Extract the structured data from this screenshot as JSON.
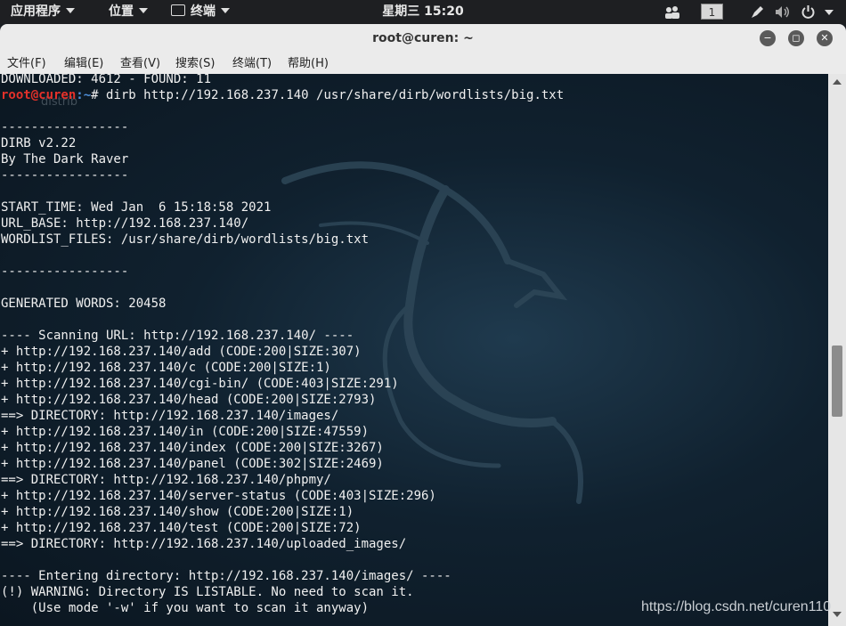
{
  "topbar": {
    "apps": "应用程序",
    "places": "位置",
    "terminal": "终端",
    "clock": "星期三 15:20",
    "workspace": "1",
    "icons": [
      "people-icon",
      "pen-icon",
      "volume-icon",
      "power-icon"
    ]
  },
  "window": {
    "title": "root@curen: ~",
    "controls": {
      "minimize": "−",
      "maximize": "◻",
      "close": "✕"
    },
    "menu": [
      "文件(F)",
      "编辑(E)",
      "查看(V)",
      "搜索(S)",
      "终端(T)",
      "帮助(H)"
    ]
  },
  "terminal": {
    "ghost": "distrib",
    "prompt": {
      "user": "root@curen",
      "path": ":~",
      "symbol": "# ",
      "command": "dirb http://192.168.237.140 /usr/share/dirb/wordlists/big.txt"
    },
    "pre_lines": [
      "DOWNLOADED: 4612 - FOUND: 11"
    ],
    "post_lines": [
      "",
      "-----------------",
      "DIRB v2.22",
      "By The Dark Raver",
      "-----------------",
      "",
      "START_TIME: Wed Jan  6 15:18:58 2021",
      "URL_BASE: http://192.168.237.140/",
      "WORDLIST_FILES: /usr/share/dirb/wordlists/big.txt",
      "",
      "-----------------",
      "",
      "GENERATED WORDS: 20458",
      "",
      "---- Scanning URL: http://192.168.237.140/ ----",
      "+ http://192.168.237.140/add (CODE:200|SIZE:307)",
      "+ http://192.168.237.140/c (CODE:200|SIZE:1)",
      "+ http://192.168.237.140/cgi-bin/ (CODE:403|SIZE:291)",
      "+ http://192.168.237.140/head (CODE:200|SIZE:2793)",
      "==> DIRECTORY: http://192.168.237.140/images/",
      "+ http://192.168.237.140/in (CODE:200|SIZE:47559)",
      "+ http://192.168.237.140/index (CODE:200|SIZE:3267)",
      "+ http://192.168.237.140/panel (CODE:302|SIZE:2469)",
      "==> DIRECTORY: http://192.168.237.140/phpmy/",
      "+ http://192.168.237.140/server-status (CODE:403|SIZE:296)",
      "+ http://192.168.237.140/show (CODE:200|SIZE:1)",
      "+ http://192.168.237.140/test (CODE:200|SIZE:72)",
      "==> DIRECTORY: http://192.168.237.140/uploaded_images/",
      "",
      "---- Entering directory: http://192.168.237.140/images/ ----",
      "(!) WARNING: Directory IS LISTABLE. No need to scan it.",
      "    (Use mode '-w' if you want to scan it anyway)"
    ]
  },
  "watermark": "https://blog.csdn.net/curen110",
  "colors": {
    "prompt_user": "#e2312a",
    "prompt_path": "#4e8fd9",
    "topbar": "#1e1f22"
  }
}
